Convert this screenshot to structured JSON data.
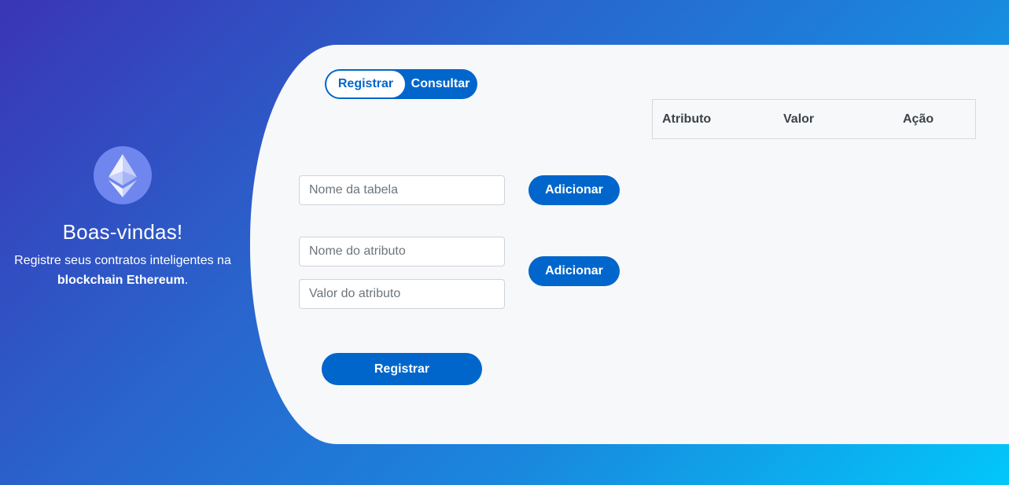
{
  "welcome": {
    "icon": "ethereum-icon",
    "title": "Boas-vindas!",
    "text_before": "Registre seus contratos inteligentes na ",
    "text_bold": "blockchain Ethereum",
    "text_after": "."
  },
  "toggle": {
    "register_label": "Registrar",
    "query_label": "Consultar"
  },
  "form": {
    "table_name_placeholder": "Nome da tabela",
    "add_table_label": "Adicionar",
    "attr_name_placeholder": "Nome do atributo",
    "attr_value_placeholder": "Valor do atributo",
    "add_attr_label": "Adicionar",
    "submit_label": "Registrar"
  },
  "table": {
    "headers": [
      "Atributo",
      "Valor",
      "Ação"
    ],
    "rows": []
  },
  "colors": {
    "primary": "#0066cc",
    "card_bg": "#f7f8fa",
    "gradient_start": "#3a35b5",
    "gradient_end": "#02c7f9"
  }
}
